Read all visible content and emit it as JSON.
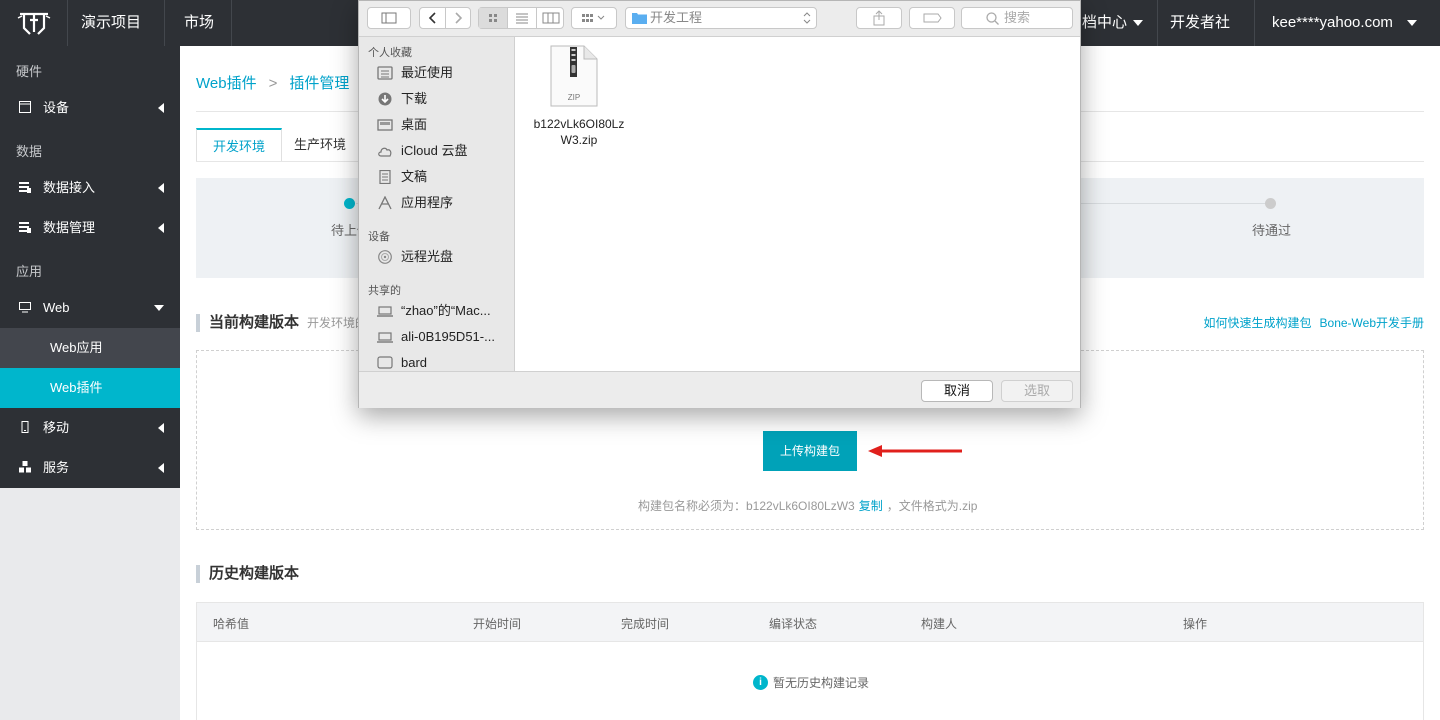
{
  "topbar": {
    "project": "演示项目",
    "market": "市场",
    "docs": "档中心",
    "community": "开发者社区",
    "account": "kee****yahoo.com"
  },
  "sidebar": {
    "sections": {
      "hardware": "硬件",
      "data": "数据",
      "app": "应用"
    },
    "items": {
      "device": "设备",
      "data_access": "数据接入",
      "data_manage": "数据管理",
      "web": "Web",
      "web_app": "Web应用",
      "web_plugin": "Web插件",
      "mobile": "移动",
      "service": "服务"
    }
  },
  "breadcrumb": {
    "first": "Web插件",
    "second": "插件管理",
    "sep": ">"
  },
  "tabs": {
    "dev": "开发环境",
    "prod": "生产环境"
  },
  "steps": {
    "first": "待上传",
    "last": "待通过"
  },
  "current_build": {
    "title": "当前构建版本",
    "subtitle": "开发环境的",
    "help_link1": "如何快速生成构建包",
    "help_link2": "Bone-Web开发手册",
    "upload_button": "上传构建包",
    "hint_prefix": "构建包名称必须为：b122vLk6OI80LzW3",
    "hint_copy": "复制",
    "hint_suffix": "，文件格式为.zip"
  },
  "history": {
    "title": "历史构建版本",
    "columns": [
      "哈希值",
      "开始时间",
      "完成时间",
      "编译状态",
      "构建人",
      "操作"
    ],
    "empty_text": "暂无历史构建记录"
  },
  "dialog": {
    "path": "开发工程",
    "search_placeholder": "搜索",
    "favorites_head": "个人收藏",
    "favorites": [
      "最近使用",
      "下载",
      "桌面",
      "iCloud 云盘",
      "文稿",
      "应用程序"
    ],
    "devices_head": "设备",
    "devices": [
      "远程光盘"
    ],
    "shared_head": "共享的",
    "shared": [
      "“zhao”的“Mac...",
      "ali-0B195D51-...",
      "bard"
    ],
    "file": {
      "name_line1": "b122vLk6OI80Lz",
      "name_line2": "W3.zip",
      "type_label": "ZIP"
    },
    "cancel": "取消",
    "choose": "选取"
  },
  "colors": {
    "accent": "#00b6cc",
    "sidebar": "#2d3035",
    "arrow": "#e0201c"
  }
}
